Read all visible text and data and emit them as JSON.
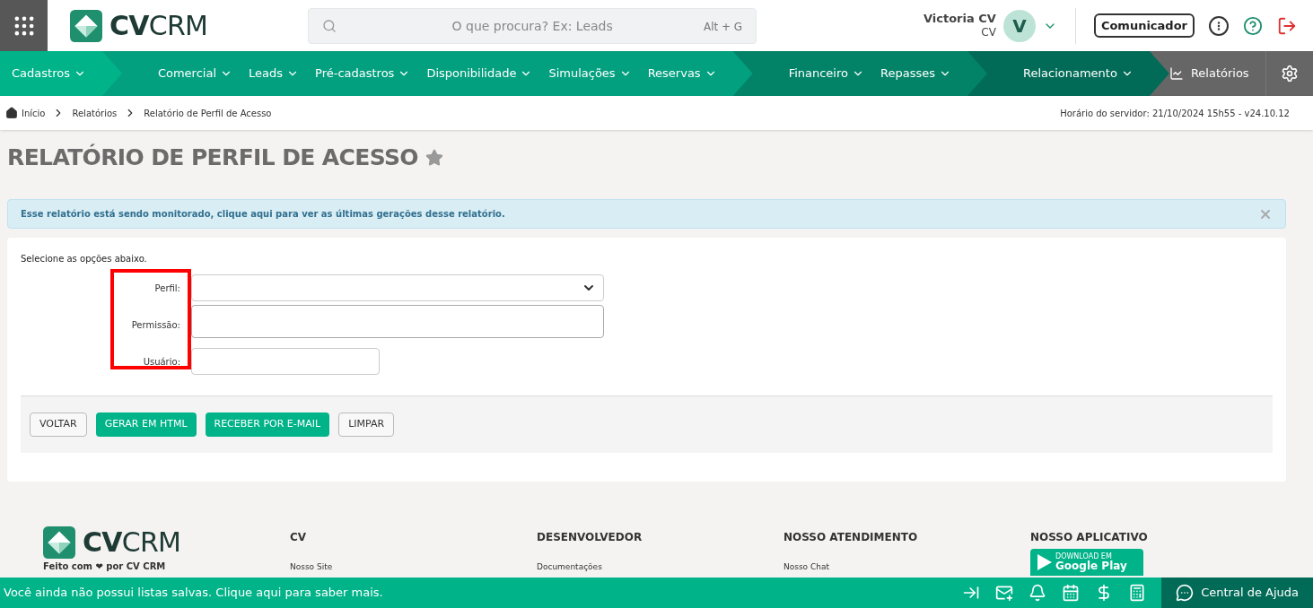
{
  "header": {
    "logo": {
      "bold": "CV",
      "light": "CRM"
    },
    "search": {
      "placeholder": "O que procura? Ex: Leads",
      "shortcut": "Alt + G"
    },
    "user": {
      "name": "Victoria CV",
      "subtitle": "CV",
      "initial": "V"
    },
    "communicator_button": "Comunicador"
  },
  "nav": {
    "groups": [
      {
        "items": [
          "Cadastros"
        ]
      },
      {
        "items": [
          "Comercial",
          "Leads",
          "Pré-cadastros",
          "Disponibilidade",
          "Simulações",
          "Reservas"
        ]
      },
      {
        "items": [
          "Financeiro",
          "Repasses"
        ]
      },
      {
        "items": [
          "Relacionamento"
        ]
      }
    ],
    "reports": "Relatórios"
  },
  "breadcrumb": [
    "Início",
    "Relatórios",
    "Relatório de Perfil de Acesso"
  ],
  "server_time": "Horário do servidor: 21/10/2024 15h55 - v24.10.12",
  "page_title": "RELATÓRIO DE PERFIL DE ACESSO",
  "alert": "Esse relatório está sendo monitorado, clique aqui para ver as últimas gerações desse relatório.",
  "form": {
    "intro": "Selecione as opções abaixo.",
    "fields": [
      {
        "label": "Perfil:",
        "kind": "select"
      },
      {
        "label": "Permissão:",
        "kind": "textarea"
      },
      {
        "label": "Usuário:",
        "kind": "text"
      }
    ],
    "buttons": [
      {
        "label": "VOLTAR",
        "kind": "outline"
      },
      {
        "label": "GERAR EM HTML",
        "kind": "primary"
      },
      {
        "label": "RECEBER POR E-MAIL",
        "kind": "primary"
      },
      {
        "label": "LIMPAR",
        "kind": "outline"
      }
    ]
  },
  "footer": {
    "logo": {
      "bold": "CV",
      "light": "CRM"
    },
    "tagline": "Feito com ❤ por CV CRM",
    "columns": [
      {
        "title": "CV",
        "link": "Nosso Site"
      },
      {
        "title": "DESENVOLVEDOR",
        "link": "Documentações"
      },
      {
        "title": "NOSSO ATENDIMENTO",
        "link": "Nosso Chat"
      },
      {
        "title": "NOSSO APLICATIVO",
        "badge_small": "DOWNLOAD EM",
        "badge": "Google Play"
      }
    ]
  },
  "bottom_bar": {
    "message": "Você ainda não possui listas salvas. Clique aqui para saber mais.",
    "help": "Central de Ajuda"
  }
}
